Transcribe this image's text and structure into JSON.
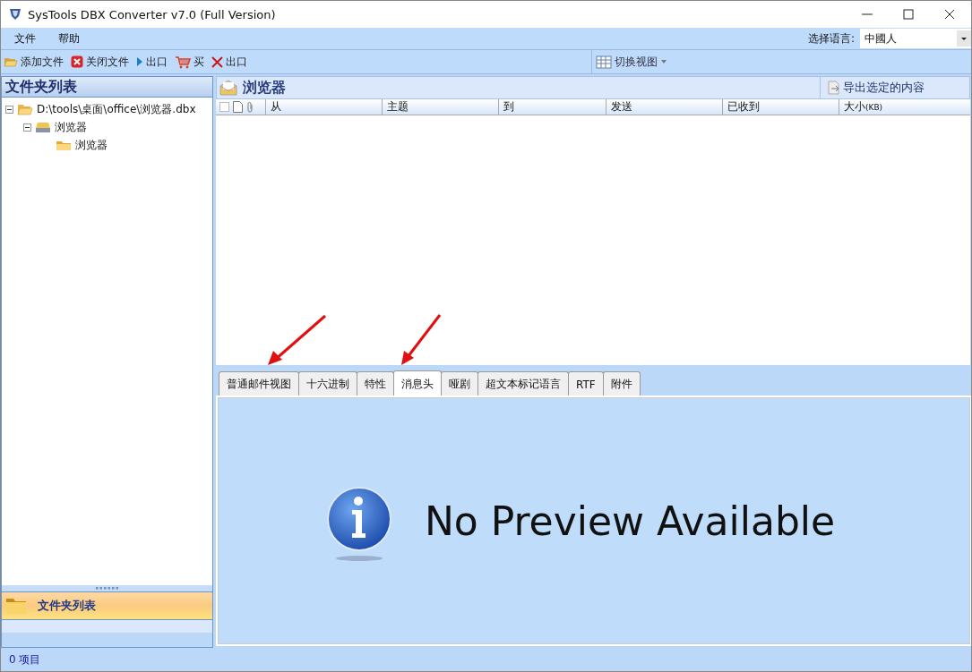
{
  "window": {
    "title": "SysTools DBX Converter v7.0 (Full Version)"
  },
  "menu": [
    "文件",
    "帮助"
  ],
  "language": {
    "label": "选择语言:",
    "value": "中國人"
  },
  "toolbar": [
    {
      "kind": "add",
      "label": "添加文件"
    },
    {
      "kind": "close",
      "label": "关闭文件"
    },
    {
      "kind": "play",
      "label": "出口"
    },
    {
      "kind": "cart",
      "label": "买"
    },
    {
      "kind": "exit",
      "label": "出口"
    }
  ],
  "switch_view": "切换视图",
  "folder_panel": {
    "title": "文件夹列表",
    "tree": [
      {
        "kind": "file",
        "label": "D:\\tools\\桌面\\office\\浏览器.dbx",
        "expanded": true,
        "children": [
          {
            "kind": "store",
            "label": "浏览器",
            "expanded": true,
            "children": [
              {
                "kind": "folder",
                "label": "浏览器"
              }
            ]
          }
        ]
      }
    ],
    "nav_button": "文件夹列表"
  },
  "mail_panel": {
    "title": "浏览器",
    "export_button": "导出选定的内容",
    "columns": [
      "从",
      "主题",
      "到",
      "发送",
      "已收到",
      "大小"
    ],
    "size_unit": "(KB)"
  },
  "preview_tabs": [
    {
      "label": "普通邮件视图",
      "selected": false
    },
    {
      "label": "十六进制",
      "selected": false
    },
    {
      "label": "特性",
      "selected": false
    },
    {
      "label": "消息头",
      "selected": true
    },
    {
      "label": "哑剧",
      "selected": false
    },
    {
      "label": "超文本标记语言",
      "selected": false
    },
    {
      "label": "RTF",
      "selected": false
    },
    {
      "label": "附件",
      "selected": false
    }
  ],
  "preview_message": "No Preview Available",
  "status_bar": "0 项目"
}
